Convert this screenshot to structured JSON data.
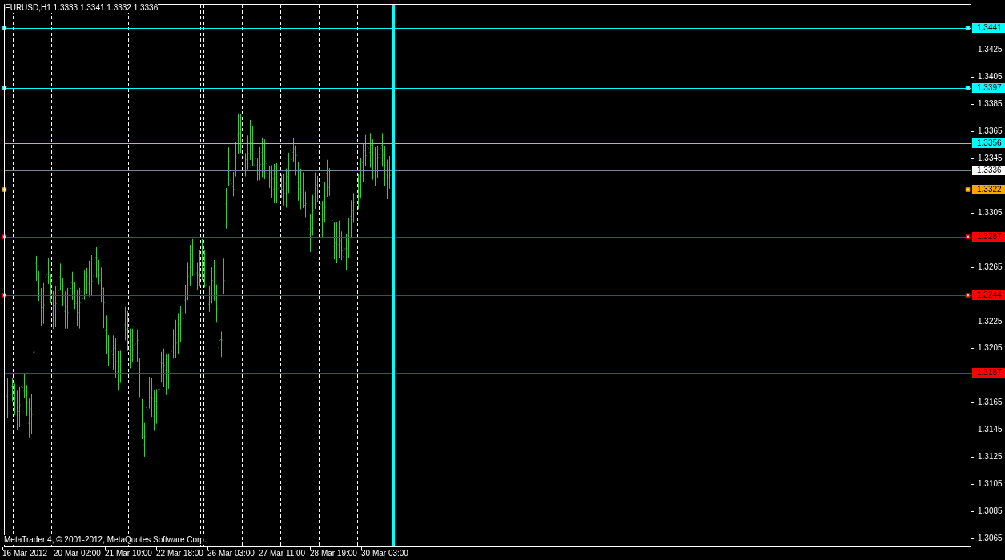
{
  "chart": {
    "title": "EURUSD,H1  1.3333 1.3341 1.3332 1.3336",
    "copyright": "MetaTrader 4, © 2001-2012, MetaQuotes Software Corp.",
    "price_ticks": [
      "1.3425",
      "1.3405",
      "1.3385",
      "1.3365",
      "1.3345",
      "1.3305",
      "1.3265",
      "1.3225",
      "1.3205",
      "1.3165",
      "1.3145",
      "1.3125",
      "1.3105",
      "1.3085",
      "1.3065"
    ],
    "time_labels": [
      "16 Mar 2012",
      "20 Mar 02:00",
      "21 Mar 10:00",
      "22 Mar 18:00",
      "26 Mar 03:00",
      "27 Mar 11:00",
      "28 Mar 19:00",
      "30 Mar 03:00"
    ],
    "levels": [
      {
        "label": "1.3441",
        "color": "#00ffff",
        "selected": true
      },
      {
        "label": "1.3397",
        "color": "#00ffff",
        "selected": true
      },
      {
        "label": "1.3356",
        "color": "#00ffff",
        "selected": false
      },
      {
        "label": "1.3336",
        "color": "#ffffff",
        "selected": false
      },
      {
        "label": "1.3322",
        "color": "#ffa500",
        "selected": true
      },
      {
        "label": "1.3287",
        "color": "#ff0000",
        "selected": true
      },
      {
        "label": "1.3244",
        "color": "#ff0000",
        "selected": true
      },
      {
        "label": "1.3187",
        "color": "#ff0000",
        "selected": false
      }
    ]
  }
}
